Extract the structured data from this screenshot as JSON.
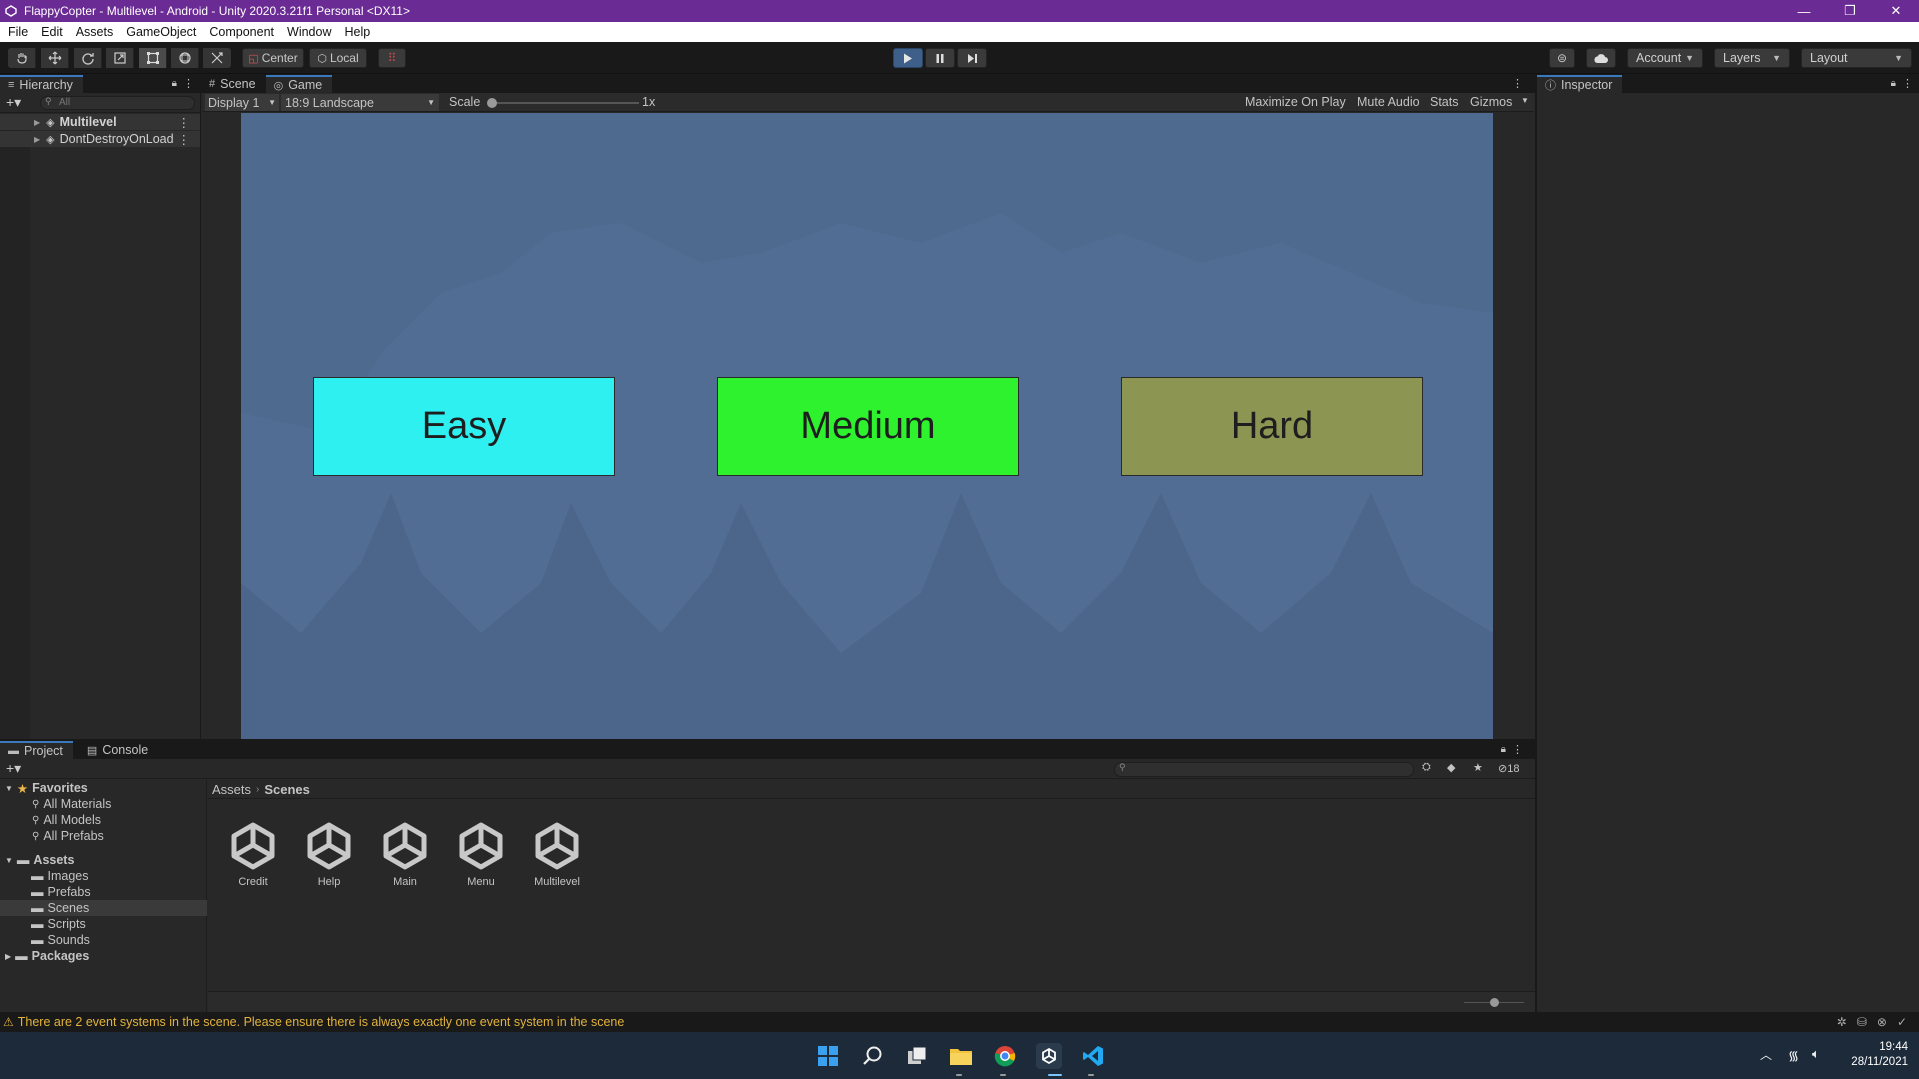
{
  "window": {
    "title": "FlappyCopter - Multilevel - Android - Unity 2020.3.21f1 Personal <DX11>",
    "controls": [
      "—",
      "❐",
      "✕"
    ]
  },
  "menu": [
    "File",
    "Edit",
    "Assets",
    "GameObject",
    "Component",
    "Window",
    "Help"
  ],
  "toolbar": {
    "pivot_label": "Center",
    "space_label": "Local",
    "account_label": "Account",
    "layers_label": "Layers",
    "layout_label": "Layout"
  },
  "hierarchy": {
    "tab": "Hierarchy",
    "search_placeholder": "All",
    "items": [
      {
        "label": "Multilevel"
      },
      {
        "label": "DontDestroyOnLoad"
      }
    ]
  },
  "center_tabs": {
    "scene": "Scene",
    "game": "Game"
  },
  "game_bar": {
    "display": "Display 1",
    "aspect": "18:9 Landscape",
    "scale_label": "Scale",
    "scale_value": "1x",
    "maximize": "Maximize On Play",
    "mute": "Mute Audio",
    "stats": "Stats",
    "gizmos": "Gizmos"
  },
  "game": {
    "buttons": [
      {
        "label": "Easy",
        "color": "#2ff0f0"
      },
      {
        "label": "Medium",
        "color": "#2ef22e"
      },
      {
        "label": "Hard",
        "color": "#8c9652"
      }
    ],
    "background": "#4f6a8f"
  },
  "inspector": {
    "tab": "Inspector"
  },
  "bottom_tabs": {
    "project": "Project",
    "console": "Console"
  },
  "project": {
    "hidden_count": "18",
    "favorites_label": "Favorites",
    "favorites": [
      "All Materials",
      "All Models",
      "All Prefabs"
    ],
    "assets_label": "Assets",
    "folders": [
      "Images",
      "Prefabs",
      "Scenes",
      "Scripts",
      "Sounds"
    ],
    "packages_label": "Packages",
    "breadcrumb": [
      "Assets",
      "Scenes"
    ],
    "scene_files": [
      "Credit",
      "Help",
      "Main",
      "Menu",
      "Multilevel"
    ]
  },
  "status": {
    "warning": "There are 2 event systems in the scene. Please ensure there is always exactly one event system in the scene"
  },
  "taskbar": {
    "time": "19:44",
    "date": "28/11/2021"
  }
}
